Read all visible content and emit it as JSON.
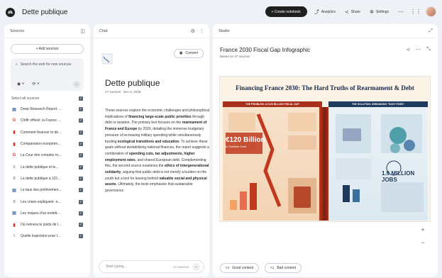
{
  "topbar": {
    "notebook_title": "Dette publique",
    "create_label": "+ Create notebook",
    "analytics_label": "Analytics",
    "share_label": "Share",
    "settings_label": "Settings"
  },
  "sources": {
    "header": "Sources",
    "add_label": "+ Add sources",
    "search_placeholder": "Search the web for new sources",
    "select_all": "Select all sources",
    "items": [
      {
        "label": "Deep Research Report: ...",
        "icon": "doc-icon",
        "color": "#4a6fb5"
      },
      {
        "label": "Chiffr officiel: la France ...",
        "icon": "google-icon",
        "color": "#e8452c"
      },
      {
        "label": "Comment financer le dé...",
        "icon": "pdf-icon",
        "color": "#d93025"
      },
      {
        "label": "Comparaison européen...",
        "icon": "pdf-icon",
        "color": "#d93025"
      },
      {
        "label": "La Cour des comptes m...",
        "icon": "google-icon",
        "color": "#e8452c"
      },
      {
        "label": "La dette publique et le...",
        "icon": "site-icon",
        "color": "#666"
      },
      {
        "label": "La dette publique à 115...",
        "icon": "site-icon",
        "color": "#1e3a5f"
      },
      {
        "label": "Le taux des prélèvemen...",
        "icon": "doc-icon",
        "color": "#4a6fb5"
      },
      {
        "label": "Les crises expliquent -e...",
        "icon": "site-icon",
        "color": "#444"
      },
      {
        "label": "Les risques d'un endett...",
        "icon": "doc-icon",
        "color": "#4a6fb5"
      },
      {
        "label": "Où mènera le poids de l...",
        "icon": "pdf-icon",
        "color": "#d93025"
      },
      {
        "label": "Quelle trajectoire pour l...",
        "icon": "site-icon",
        "color": "#888"
      }
    ]
  },
  "chat": {
    "header": "Chat",
    "convert_label": "Convert",
    "title": "Dette publique",
    "meta": "17 sources · Dec 6, 2025",
    "summary_parts": [
      {
        "t": "These sources explore the economic challenges and philosophical implications of ",
        "b": false
      },
      {
        "t": "financing large-scale public priorities",
        "b": true
      },
      {
        "t": " through debt or taxation. The primary text focuses on the ",
        "b": false
      },
      {
        "t": "rearmament of France and Europe",
        "b": true
      },
      {
        "t": " by 2030, detailing the immense budgetary pressure of increasing military spending while simultaneously funding ",
        "b": false
      },
      {
        "t": "ecological transitions and education",
        "b": true
      },
      {
        "t": ". To achieve these goals without destabilizing national finances, the report suggests a combination of ",
        "b": false
      },
      {
        "t": "spending cuts, tax adjustments, higher employment rates",
        "b": true
      },
      {
        "t": ", and shared European debt. Complementing this, the second source examines the ",
        "b": false
      },
      {
        "t": "ethics of intergenerational solidarity",
        "b": true
      },
      {
        "t": ", arguing that public debt is not merely a burden on the youth but a tool for leaving behind ",
        "b": false
      },
      {
        "t": "valuable social and physical assets",
        "b": true
      },
      {
        "t": ". Ultimately, the texts emphasize that sustainable governance",
        "b": false
      }
    ],
    "input_placeholder": "Start typing...",
    "source_count": "17 sources"
  },
  "studio": {
    "header": "Studio",
    "title": "France 2030 Fiscal Gap Infographic",
    "subtitle": "Based on 17 sources",
    "infographic": {
      "title": "Financing France 2030: The Hard Truths of Rearmament & Debt",
      "left_banner": "THE PROBLEM: A €120 BILLION FISCAL GAP",
      "right_banner": "THE SOLUTION: DEBUNKING \"EASY FIXES\"",
      "big_value": "€120 Billion",
      "big_caption": "to Stabilize Debt",
      "jobs_value": "1.9 MILLION JOBS"
    },
    "good_label": "Good content",
    "bad_label": "Bad content"
  }
}
